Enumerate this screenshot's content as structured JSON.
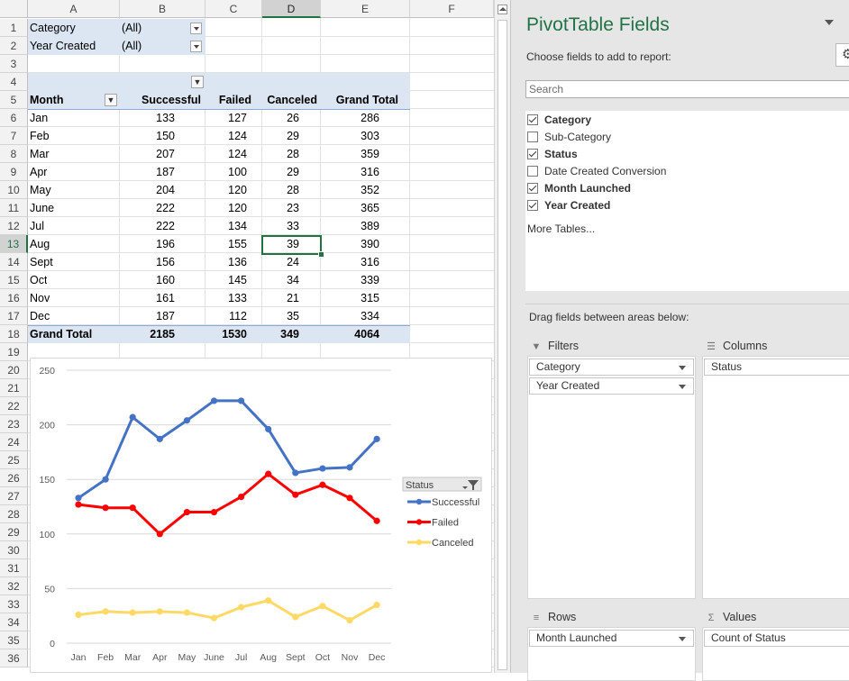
{
  "columns": [
    "A",
    "B",
    "C",
    "D",
    "E",
    "F"
  ],
  "rows": [
    "1",
    "2",
    "3",
    "4",
    "5",
    "6",
    "7",
    "8",
    "9",
    "10",
    "11",
    "12",
    "13",
    "14",
    "15",
    "16",
    "17",
    "18",
    "19",
    "20",
    "21",
    "22",
    "23",
    "24",
    "25",
    "26",
    "27",
    "28",
    "29",
    "30",
    "31",
    "32",
    "33",
    "34",
    "35",
    "36"
  ],
  "filters": [
    {
      "label": "Category",
      "value": "(All)"
    },
    {
      "label": "Year Created",
      "value": "(All)"
    }
  ],
  "pivot": {
    "headers": [
      "Month",
      "Successful",
      "Failed",
      "Canceled",
      "Grand Total"
    ],
    "rows": [
      [
        "Jan",
        "133",
        "127",
        "26",
        "286"
      ],
      [
        "Feb",
        "150",
        "124",
        "29",
        "303"
      ],
      [
        "Mar",
        "207",
        "124",
        "28",
        "359"
      ],
      [
        "Apr",
        "187",
        "100",
        "29",
        "316"
      ],
      [
        "May",
        "204",
        "120",
        "28",
        "352"
      ],
      [
        "June",
        "222",
        "120",
        "23",
        "365"
      ],
      [
        "Jul",
        "222",
        "134",
        "33",
        "389"
      ],
      [
        "Aug",
        "196",
        "155",
        "39",
        "390"
      ],
      [
        "Sept",
        "156",
        "136",
        "24",
        "316"
      ],
      [
        "Oct",
        "160",
        "145",
        "34",
        "339"
      ],
      [
        "Nov",
        "161",
        "133",
        "21",
        "315"
      ],
      [
        "Dec",
        "187",
        "112",
        "35",
        "334"
      ]
    ],
    "total": [
      "Grand Total",
      "2185",
      "1530",
      "349",
      "4064"
    ]
  },
  "chart_data": {
    "type": "line",
    "categories": [
      "Jan",
      "Feb",
      "Mar",
      "Apr",
      "May",
      "June",
      "Jul",
      "Aug",
      "Sept",
      "Oct",
      "Nov",
      "Dec"
    ],
    "series": [
      {
        "name": "Successful",
        "color": "#4472c4",
        "values": [
          133,
          150,
          207,
          187,
          204,
          222,
          222,
          196,
          156,
          160,
          161,
          187
        ]
      },
      {
        "name": "Failed",
        "color": "#ff0000",
        "values": [
          127,
          124,
          124,
          100,
          120,
          120,
          134,
          155,
          136,
          145,
          133,
          112
        ]
      },
      {
        "name": "Canceled",
        "color": "#ffd966",
        "values": [
          26,
          29,
          28,
          29,
          28,
          23,
          33,
          39,
          24,
          34,
          21,
          35
        ]
      }
    ],
    "yticks": [
      "0",
      "50",
      "100",
      "150",
      "200",
      "250"
    ],
    "ylim": [
      0,
      250
    ],
    "grid": true,
    "legend_title": "Status",
    "legend_position": "right"
  },
  "panel": {
    "title": "PivotTable Fields",
    "subtitle": "Choose fields to add to report:",
    "search_placeholder": "Search",
    "fields": [
      {
        "label": "Category",
        "checked": true
      },
      {
        "label": "Sub-Category",
        "checked": false
      },
      {
        "label": "Status",
        "checked": true
      },
      {
        "label": "Date Created Conversion",
        "checked": false
      },
      {
        "label": "Month Launched",
        "checked": true
      },
      {
        "label": "Year Created",
        "checked": true
      }
    ],
    "more_tables": "More Tables...",
    "drag_label": "Drag fields between areas below:",
    "areas": {
      "filters": {
        "label": "Filters",
        "items": [
          "Category",
          "Year Created"
        ]
      },
      "columns": {
        "label": "Columns",
        "items": [
          "Status"
        ]
      },
      "rows": {
        "label": "Rows",
        "items": [
          "Month Launched"
        ]
      },
      "values": {
        "label": "Values",
        "items": [
          "Count of Status"
        ]
      }
    }
  }
}
